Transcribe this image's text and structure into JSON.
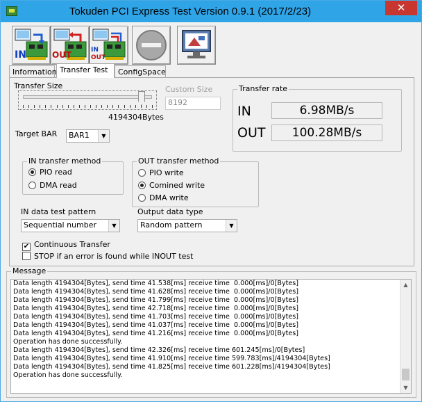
{
  "window": {
    "title": "Tokuden PCI Express Test Version 0.9.1 (2017/2/23)",
    "close_glyph": "✕"
  },
  "toolbar": {
    "buttons": [
      {
        "icon": "in-transfer-icon",
        "badge": "IN"
      },
      {
        "icon": "out-transfer-icon",
        "badge": "OUT"
      },
      {
        "icon": "inout-transfer-icon",
        "badge": "IN OUT"
      },
      {
        "icon": "stop-icon",
        "badge": ""
      },
      {
        "icon": "monitor-icon",
        "badge": ""
      }
    ]
  },
  "tabs": [
    {
      "label": "Information",
      "active": false
    },
    {
      "label": "Transfer Test",
      "active": true
    },
    {
      "label": "ConfigSpace",
      "active": false
    }
  ],
  "transfer": {
    "size_label": "Transfer Size",
    "size_value_text": "4194304Bytes",
    "size_fraction": 0.92,
    "custom_size_label": "Custom Size",
    "custom_size_value": "8192",
    "target_bar_label": "Target BAR",
    "target_bar_value": "BAR1"
  },
  "rate": {
    "group_label": "Transfer rate",
    "in_label": "IN",
    "in_value": "6.98MB/s",
    "out_label": "OUT",
    "out_value": "100.28MB/s"
  },
  "in_method": {
    "group_label": "IN transfer method",
    "options": [
      {
        "label": "PIO read",
        "checked": true
      },
      {
        "label": "DMA read",
        "checked": false
      }
    ]
  },
  "out_method": {
    "group_label": "OUT transfer method",
    "options": [
      {
        "label": "PIO write",
        "checked": false
      },
      {
        "label": "Comined write",
        "checked": true
      },
      {
        "label": "DMA write",
        "checked": false
      }
    ]
  },
  "in_pattern": {
    "label": "IN data test pattern",
    "value": "Sequential number"
  },
  "output_type": {
    "label": "Output data type",
    "value": "Random pattern"
  },
  "options": {
    "continuous": {
      "label": "Continuous Transfer",
      "checked": true
    },
    "stop_on_error": {
      "label": "STOP if an error is found while INOUT test",
      "checked": false
    }
  },
  "message": {
    "group_label": "Message",
    "lines": [
      "Data length 4194304[Bytes], send time 41.538[ms] receive time  0.000[ms]/0[Bytes]",
      "Data length 4194304[Bytes], send time 41.628[ms] receive time  0.000[ms]/0[Bytes]",
      "Data length 4194304[Bytes], send time 41.799[ms] receive time  0.000[ms]/0[Bytes]",
      "Data length 4194304[Bytes], send time 42.718[ms] receive time  0.000[ms]/0[Bytes]",
      "Data length 4194304[Bytes], send time 41.703[ms] receive time  0.000[ms]/0[Bytes]",
      "Data length 4194304[Bytes], send time 41.037[ms] receive time  0.000[ms]/0[Bytes]",
      "Data length 4194304[Bytes], send time 41.216[ms] receive time  0.000[ms]/0[Bytes]",
      "Operation has done successfully.",
      "Data length 4194304[Bytes], send time 42.326[ms] receive time 601.245[ms]/0[Bytes]",
      "Data length 4194304[Bytes], send time 41.910[ms] receive time 599.783[ms]/4194304[Bytes]",
      "Data length 4194304[Bytes], send time 41.825[ms] receive time 601.228[ms]/4194304[Bytes]",
      "Operation has done successfully."
    ]
  }
}
